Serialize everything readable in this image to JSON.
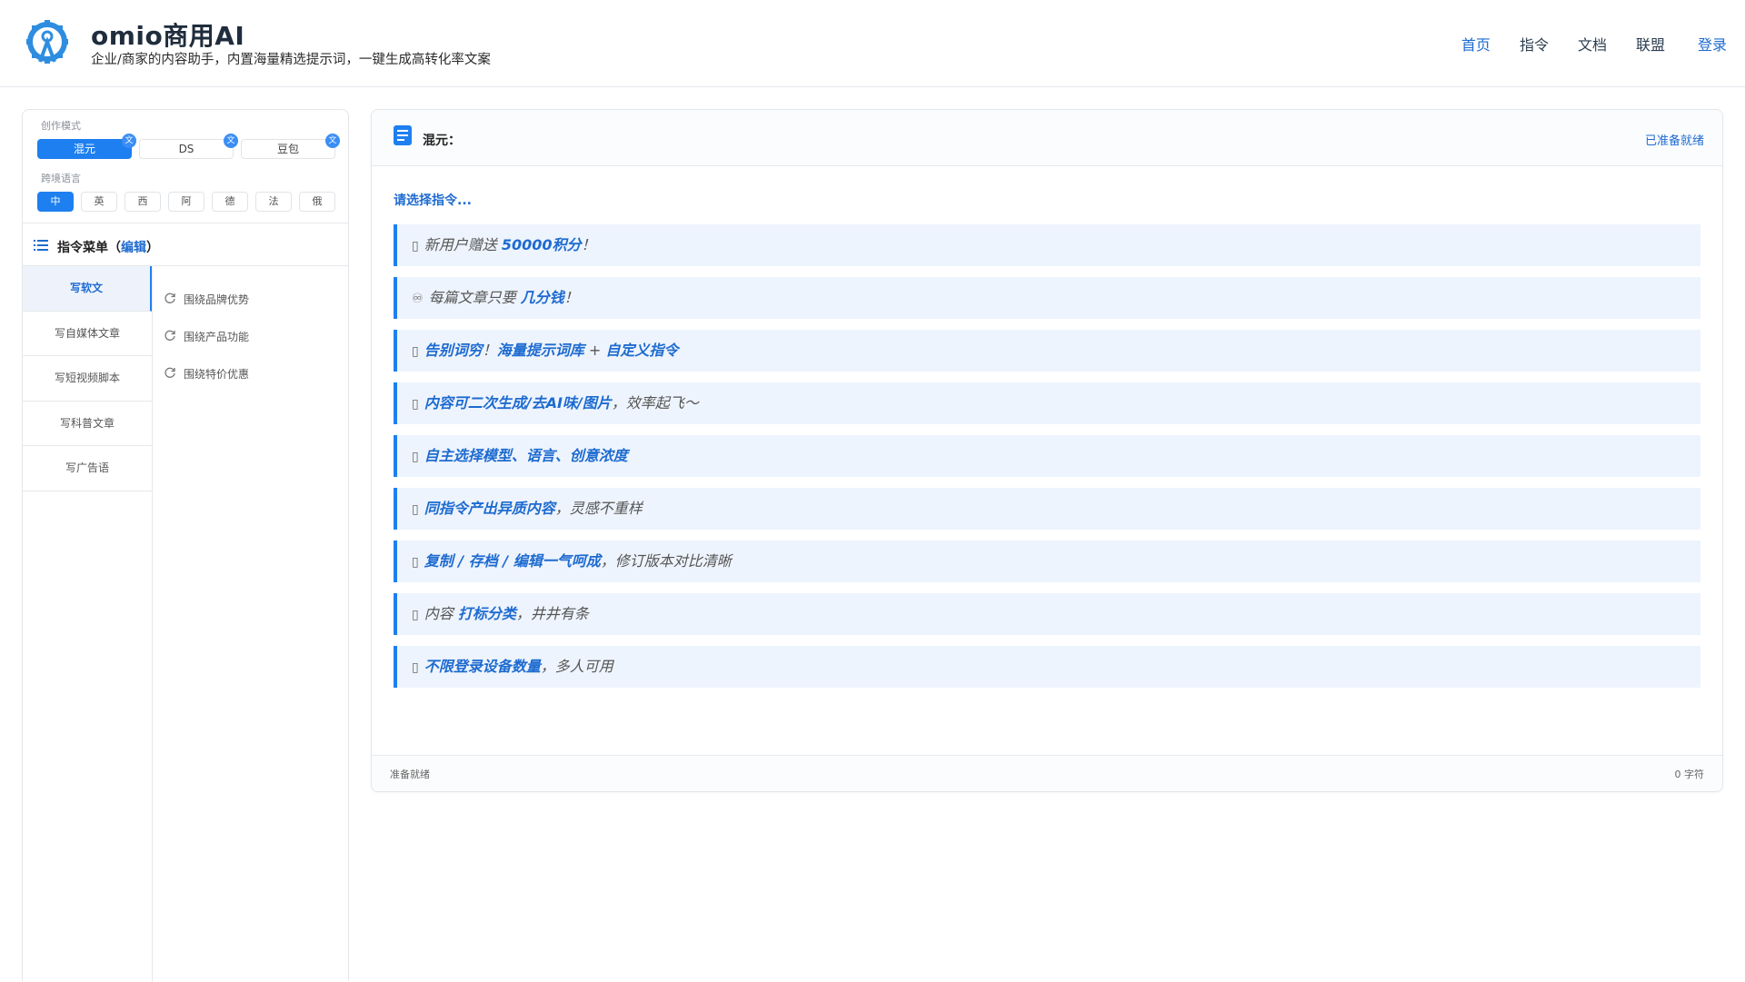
{
  "header": {
    "brand_title": "omio商用AI",
    "brand_subtitle": "企业/商家的内容助手，内置海量精选提示词，一键生成高转化率文案",
    "nav": [
      "首页",
      "指令",
      "文档",
      "联盟"
    ],
    "login_label": "登录"
  },
  "sidebar": {
    "mode_label": "创作模式",
    "modes": [
      {
        "label": "混元",
        "badge": "文"
      },
      {
        "label": "DS",
        "badge": "文"
      },
      {
        "label": "豆包",
        "badge": "文"
      }
    ],
    "language_label": "跨境语言",
    "languages": [
      "中",
      "英",
      "西",
      "阿",
      "德",
      "法",
      "俄"
    ],
    "menu_title": "指令菜单（",
    "menu_edit": "编辑",
    "menu_title_end": "）",
    "menu_items": [
      "写软文",
      "写自媒体文章",
      "写短视频脚本",
      "写科普文章",
      "写广告语"
    ],
    "sub_items": [
      "围绕品牌优势",
      "围绕产品功能",
      "围绕特价优惠"
    ]
  },
  "panel": {
    "title": "混元：",
    "status": "已准备就绪",
    "prompt": "请选择指令...",
    "features": [
      {
        "icon": "▯",
        "parts": [
          [
            "新用户赠送 ",
            false
          ],
          [
            "50000积分",
            true
          ],
          [
            "！",
            false
          ]
        ]
      },
      {
        "icon": "♾",
        "parts": [
          [
            "每篇文章只要 ",
            false
          ],
          [
            "几分钱",
            true
          ],
          [
            "！",
            false
          ]
        ]
      },
      {
        "icon": "▯",
        "parts": [
          [
            "告别词穷",
            true
          ],
          [
            "！",
            false
          ],
          [
            "海量提示词库",
            true
          ],
          [
            " + ",
            false
          ],
          [
            "自定义指令",
            true
          ]
        ]
      },
      {
        "icon": "▯",
        "parts": [
          [
            "内容可二次生成/去AI味/图片",
            true
          ],
          [
            "，效率起飞～",
            false
          ]
        ]
      },
      {
        "icon": "▯",
        "parts": [
          [
            "自主选择模型、语言、创意浓度",
            true
          ]
        ]
      },
      {
        "icon": "▯",
        "parts": [
          [
            "同指令产出异质内容",
            true
          ],
          [
            "，灵感不重样",
            false
          ]
        ]
      },
      {
        "icon": "▯",
        "parts": [
          [
            "复制 / 存档 / 编辑一气呵成",
            true
          ],
          [
            "，修订版本对比清晰",
            false
          ]
        ]
      },
      {
        "icon": "▯",
        "parts": [
          [
            "内容 ",
            false
          ],
          [
            "打标分类",
            true
          ],
          [
            "，井井有条",
            false
          ]
        ]
      },
      {
        "icon": "▯",
        "parts": [
          [
            "不限登录设备数量",
            true
          ],
          [
            "，多人可用",
            false
          ]
        ]
      }
    ],
    "footer_left": "准备就绪",
    "footer_right": "0 字符"
  },
  "colors": {
    "accent": "#1e7ff0",
    "link": "#1e6bd0",
    "feature_bg": "#eef4fd"
  }
}
